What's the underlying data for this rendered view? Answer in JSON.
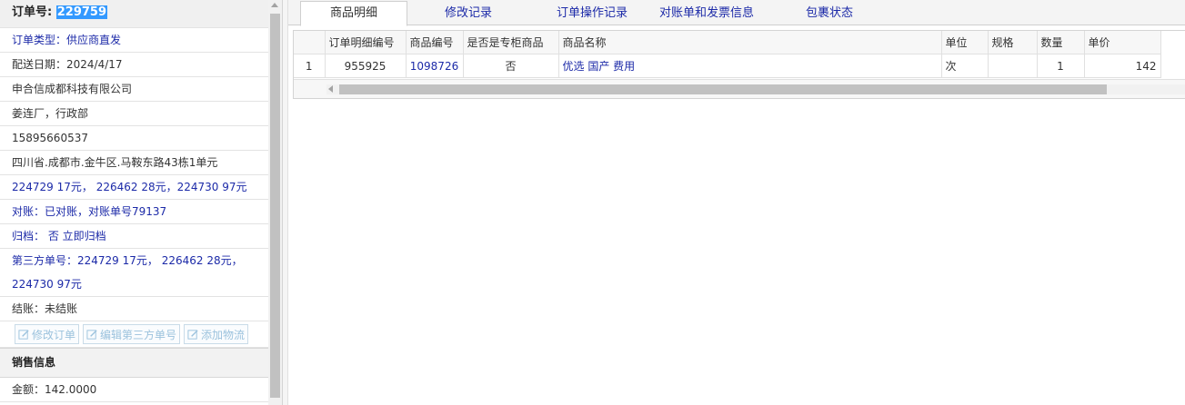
{
  "order": {
    "label": "订单号:",
    "number": "229759",
    "type": "订单类型：供应商直发",
    "delivery_date": "配送日期：2024/4/17",
    "company": "申合信成都科技有限公司",
    "contact": "姜连厂，行政部",
    "phone": "15895660537",
    "address": "四川省.成都市.金牛区.马鞍东路43栋1单元",
    "amounts": "224729 17元， 226462 28元，224730 97元",
    "reconcile": "对账：已对账，对账单号79137",
    "archive": "归档： 否 立即归档",
    "third_party_line1": "第三方单号：224729 17元， 226462 28元，",
    "third_party_line2": "224730 97元",
    "settlement": "结账：未结账"
  },
  "actions": {
    "edit_order": "修改订单",
    "edit_third_party": "编辑第三方单号",
    "add_logistics": "添加物流"
  },
  "sales": {
    "title": "销售信息",
    "amount": "金额：142.0000"
  },
  "tabs": [
    "商品明细",
    "修改记录",
    "订单操作记录",
    "对账单和发票信息",
    "包裹状态"
  ],
  "grid": {
    "columns": [
      "订单明细编号",
      "商品编号",
      "是否是专柜商品",
      "商品名称",
      "单位",
      "规格",
      "数量",
      "单价"
    ],
    "rows": [
      {
        "index": "1",
        "detail_id": "955925",
        "product_id": "1098726",
        "is_counter": "否",
        "name": "优选 国产 费用",
        "unit": "次",
        "spec": "",
        "qty": "1",
        "price": "142"
      }
    ]
  },
  "colors": {
    "link": "#1c2aa8",
    "highlight": "#3399ff",
    "button_text": "#9bc2dd"
  }
}
